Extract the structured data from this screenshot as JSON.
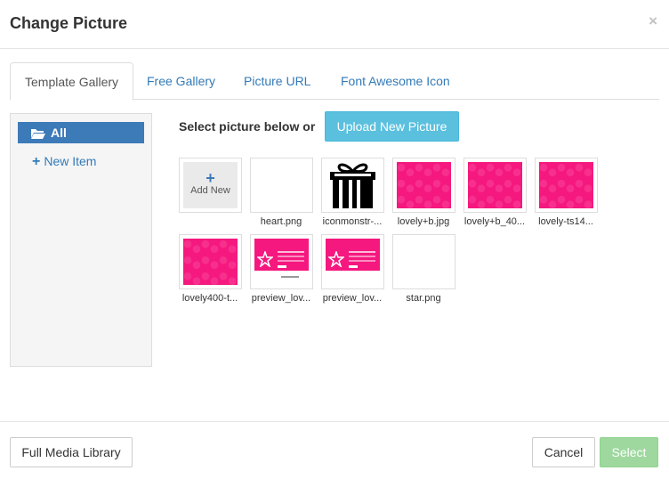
{
  "dialog": {
    "title": "Change Picture",
    "close_label": "×"
  },
  "tabs": [
    {
      "label": "Template Gallery",
      "active": true
    },
    {
      "label": "Free Gallery",
      "active": false
    },
    {
      "label": "Picture URL",
      "active": false
    },
    {
      "label": "Font Awesome Icon",
      "active": false
    }
  ],
  "sidebar": {
    "all_label": "All",
    "new_item_label": "New Item"
  },
  "main": {
    "select_text": "Select picture below or",
    "upload_label": "Upload New Picture"
  },
  "gallery": {
    "add_new_label": "Add New",
    "items": [
      {
        "caption": "heart.png"
      },
      {
        "caption": "iconmonstr-..."
      },
      {
        "caption": "lovely+b.jpg"
      },
      {
        "caption": "lovely+b_40..."
      },
      {
        "caption": "lovely-ts14..."
      },
      {
        "caption": "lovely400-t..."
      },
      {
        "caption": "preview_lov..."
      },
      {
        "caption": "preview_lov..."
      },
      {
        "caption": "star.png"
      }
    ]
  },
  "footer": {
    "library_label": "Full Media Library",
    "cancel_label": "Cancel",
    "select_label": "Select"
  },
  "colors": {
    "accent": "#3d7ab8",
    "info": "#5bc0de",
    "success_disabled": "#9ed89e",
    "pink": "#f5187f"
  }
}
